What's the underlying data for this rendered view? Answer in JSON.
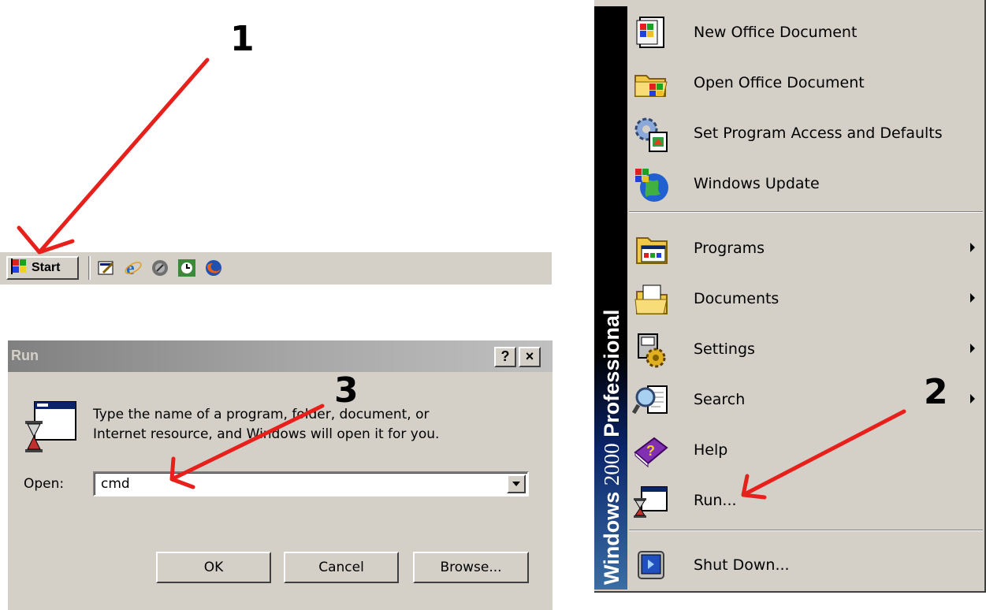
{
  "taskbar": {
    "start_label": "Start",
    "quick_launch": [
      "show-desktop-icon",
      "internet-explorer-icon",
      "media-icon",
      "clock-app-icon",
      "firefox-icon"
    ]
  },
  "run_dialog": {
    "title": "Run",
    "help_button": "?",
    "close_button": "×",
    "description_line1": "Type the name of a program, folder, document, or",
    "description_line2": "Internet resource, and Windows will open it for you.",
    "open_label": "Open:",
    "open_value": "cmd",
    "ok_label": "OK",
    "cancel_label": "Cancel",
    "browse_label": "Browse..."
  },
  "start_menu": {
    "banner": {
      "brand": "Windows",
      "version": "2000",
      "edition": "Professional"
    },
    "top_items": [
      {
        "label": "New Office Document",
        "icon": "new-office-document-icon"
      },
      {
        "label": "Open Office Document",
        "icon": "open-office-document-icon"
      },
      {
        "label": "Set Program Access and Defaults",
        "icon": "program-access-icon"
      },
      {
        "label": "Windows Update",
        "icon": "windows-update-icon"
      }
    ],
    "main_items": [
      {
        "label": "Programs",
        "icon": "programs-icon",
        "submenu": true
      },
      {
        "label": "Documents",
        "icon": "documents-icon",
        "submenu": true
      },
      {
        "label": "Settings",
        "icon": "settings-icon",
        "submenu": true
      },
      {
        "label": "Search",
        "icon": "search-icon",
        "submenu": true
      },
      {
        "label": "Help",
        "icon": "help-icon",
        "submenu": false
      },
      {
        "label": "Run...",
        "icon": "run-icon",
        "submenu": false
      }
    ],
    "shutdown": {
      "label": "Shut Down...",
      "icon": "shut-down-icon"
    }
  },
  "annotations": {
    "step1": "1",
    "step2": "2",
    "step3": "3",
    "arrow_color": "#e8201c"
  }
}
